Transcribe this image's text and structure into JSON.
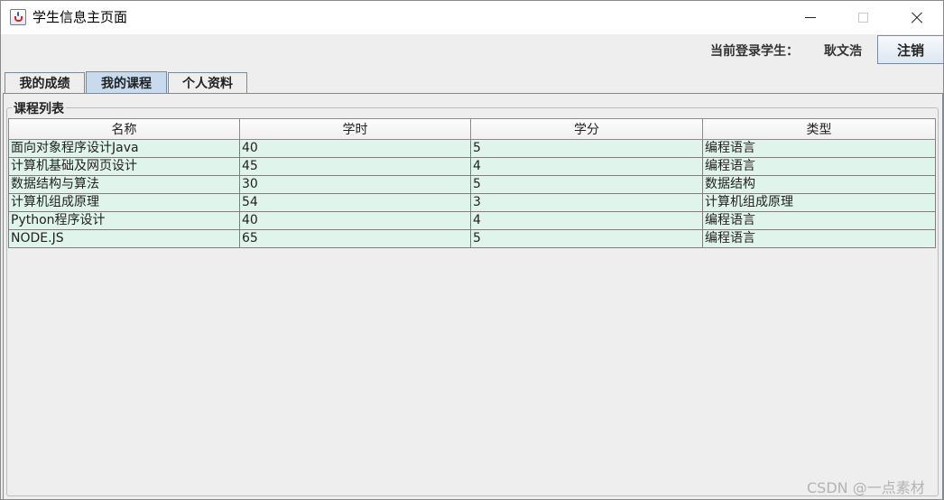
{
  "window": {
    "title": "学生信息主页面"
  },
  "header": {
    "login_label": "当前登录学生：",
    "user_name": "耿文浩",
    "logout_label": "注销"
  },
  "tabs": [
    {
      "label": "我的成绩",
      "active": false
    },
    {
      "label": "我的课程",
      "active": true
    },
    {
      "label": "个人资料",
      "active": false
    }
  ],
  "course_panel": {
    "title": "课程列表"
  },
  "table": {
    "columns": [
      "名称",
      "学时",
      "学分",
      "类型"
    ],
    "rows": [
      [
        "面向对象程序设计Java",
        "40",
        "5",
        "编程语言"
      ],
      [
        "计算机基础及网页设计",
        "45",
        "4",
        "编程语言"
      ],
      [
        "数据结构与算法",
        "30",
        "5",
        "数据结构"
      ],
      [
        "计算机组成原理",
        "54",
        "3",
        "计算机组成原理"
      ],
      [
        "Python程序设计",
        "40",
        "4",
        "编程语言"
      ],
      [
        "NODE.JS",
        "65",
        "5",
        "编程语言"
      ]
    ]
  },
  "watermark": "CSDN @一点素材",
  "icons": {
    "app": "java-cup-icon",
    "minimize": "minimize-icon",
    "maximize": "maximize-icon",
    "close": "close-icon"
  },
  "colors": {
    "active_tab": "#c8dbee",
    "table_row_bg": "#dff4ea",
    "group_border": "#a9c0d8"
  }
}
